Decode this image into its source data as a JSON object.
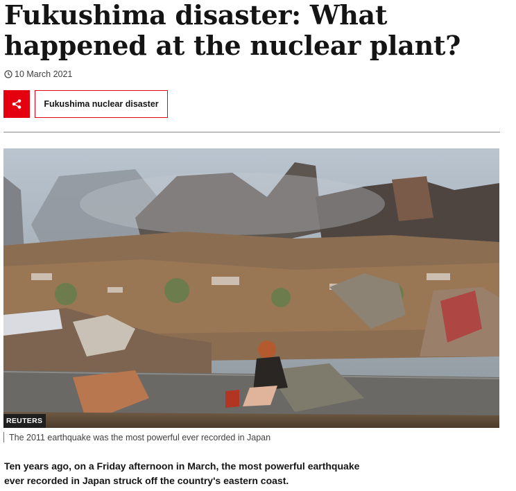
{
  "article": {
    "headline": "Fukushima disaster: What happened at the nuclear plant?",
    "date": "10 March 2021",
    "share_icon": "share-icon",
    "clock_icon": "clock-icon",
    "topic_tag": "Fukushima nuclear disaster",
    "image": {
      "description_icon": "tsunami-aftermath-photo",
      "credit": "REUTERS",
      "caption": "The 2011 earthquake was the most powerful ever recorded in Japan"
    },
    "intro": "Ten years ago, on a Friday afternoon in March, the most powerful earthquake ever recorded in Japan struck off the country's eastern coast."
  },
  "colors": {
    "accent": "#e5000f",
    "text": "#141414",
    "muted": "#3f3f42"
  }
}
